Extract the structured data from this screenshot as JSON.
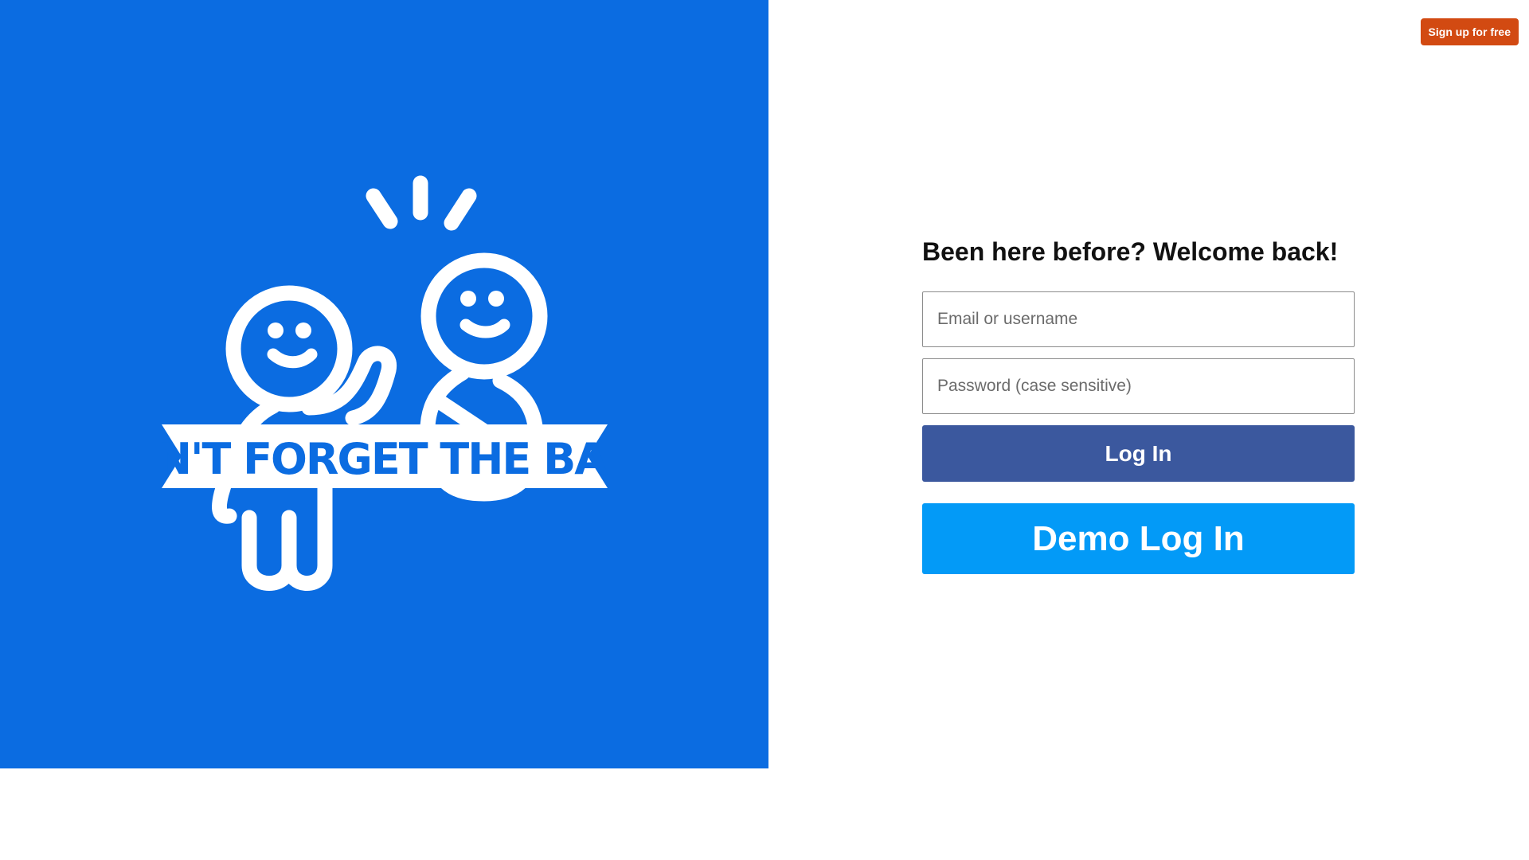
{
  "brand": {
    "logo_text": "DON'T FORGET THE BABY!",
    "panel_color": "#0b6ce1",
    "logo_icon": "parent-and-baby-icon"
  },
  "header": {
    "signup_label": "Sign up for free",
    "signup_color": "#d24a12"
  },
  "login": {
    "heading": "Been here before? Welcome back!",
    "email_placeholder": "Email or username",
    "password_placeholder": "Password (case sensitive)",
    "login_label": "Log In",
    "login_color": "#3b589e",
    "demo_label": "Demo Log In",
    "demo_color": "#039af7"
  }
}
